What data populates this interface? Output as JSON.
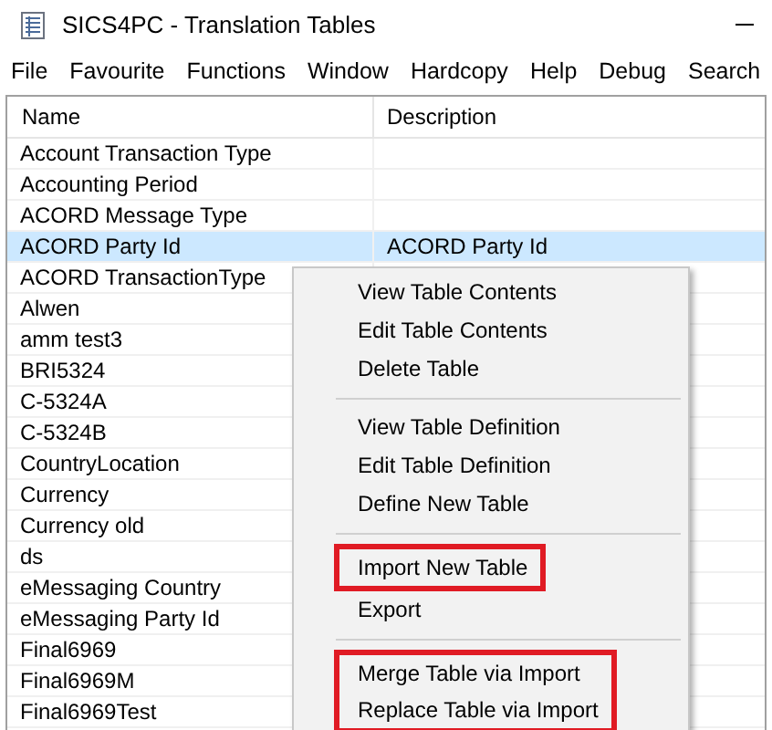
{
  "window": {
    "title": "SICS4PC - Translation Tables"
  },
  "menu_bar": [
    "File",
    "Favourite",
    "Functions",
    "Window",
    "Hardcopy",
    "Help",
    "Debug",
    "Search"
  ],
  "table": {
    "columns": [
      "Name",
      "Description"
    ],
    "rows": [
      {
        "name": "Account Transaction Type",
        "selected": false
      },
      {
        "name": "Accounting Period",
        "selected": false
      },
      {
        "name": "ACORD Message Type",
        "selected": false
      },
      {
        "name": "ACORD Party Id",
        "description": "ACORD Party Id",
        "selected": true
      },
      {
        "name": "ACORD TransactionType",
        "selected": false
      },
      {
        "name": "Alwen",
        "selected": false
      },
      {
        "name": "amm test3",
        "selected": false
      },
      {
        "name": "BRI5324",
        "selected": false
      },
      {
        "name": "C-5324A",
        "selected": false
      },
      {
        "name": "C-5324B",
        "selected": false
      },
      {
        "name": "CountryLocation",
        "selected": false
      },
      {
        "name": "Currency",
        "selected": false
      },
      {
        "name": "Currency old",
        "selected": false
      },
      {
        "name": "ds",
        "selected": false
      },
      {
        "name": "eMessaging Country",
        "selected": false
      },
      {
        "name": "eMessaging Party Id",
        "selected": false
      },
      {
        "name": "Final6969",
        "selected": false
      },
      {
        "name": "Final6969M",
        "selected": false
      },
      {
        "name": "Final6969Test",
        "selected": false
      }
    ]
  },
  "context_menu": [
    {
      "kind": "item",
      "label": "View Table Contents"
    },
    {
      "kind": "item",
      "label": "Edit Table Contents"
    },
    {
      "kind": "item",
      "label": "Delete Table"
    },
    {
      "kind": "separator"
    },
    {
      "kind": "item",
      "label": "View Table Definition"
    },
    {
      "kind": "item",
      "label": "Edit Table Definition"
    },
    {
      "kind": "item",
      "label": "Define New Table"
    },
    {
      "kind": "separator"
    },
    {
      "kind": "highlight",
      "items": [
        "Import New Table"
      ]
    },
    {
      "kind": "item",
      "label": "Export"
    },
    {
      "kind": "separator"
    },
    {
      "kind": "highlight",
      "items": [
        "Merge Table via Import",
        "Replace Table via Import"
      ]
    }
  ]
}
